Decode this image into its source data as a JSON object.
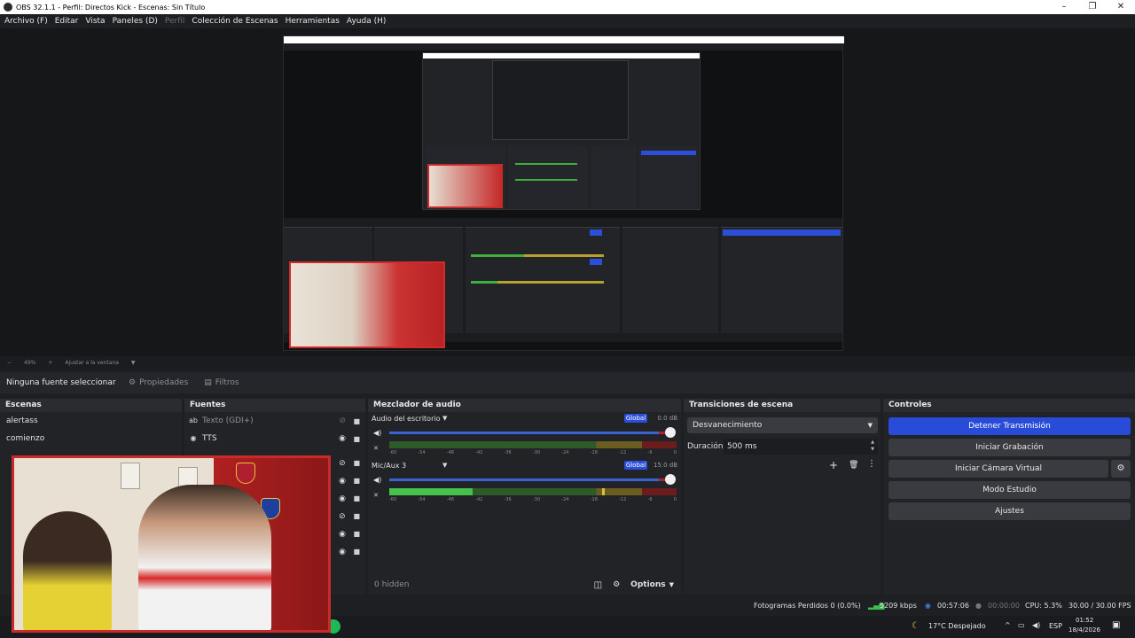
{
  "window": {
    "title": "OBS 32.1.1 - Perfil: Directos Kick - Escenas: Sin Título",
    "controls": [
      "–",
      "❐",
      "✕"
    ]
  },
  "menu": [
    "Archivo (F)",
    "Editar",
    "Vista",
    "Paneles (D)",
    "Perfil",
    "Colección de Escenas",
    "Herramientas",
    "Ayuda (H)"
  ],
  "scale": {
    "zoom": "49%",
    "fit_label": "Ajustar a la ventana"
  },
  "source_toolbar": {
    "no_source": "Ninguna fuente seleccionar",
    "properties": "Propiedades",
    "filters": "Filtros"
  },
  "docks": {
    "scenes": {
      "title": "Escenas",
      "items": [
        "alertass",
        "comienzo"
      ]
    },
    "sources": {
      "title": "Fuentes",
      "items": [
        {
          "icon": "text-icon",
          "label": "Texto (GDI+)",
          "visible": false
        },
        {
          "icon": "browser-icon",
          "label": "TTS",
          "visible": true
        }
      ]
    },
    "mixer": {
      "title": "Mezclador de audio",
      "channels": [
        {
          "name": "Audio del escritorio",
          "badge": "Global",
          "db": "0.0 dB",
          "level": 0.0
        },
        {
          "name": "Mic/Aux 3",
          "badge": "Global",
          "db": "15.0 dB",
          "level": 0.29
        }
      ],
      "ticks": [
        "-60",
        "-54",
        "-48",
        "-42",
        "-36",
        "-30",
        "-24",
        "-18",
        "-12",
        "-6",
        "0"
      ],
      "hidden": "0 hidden",
      "options": "Options"
    },
    "transitions": {
      "title": "Transiciones de escena",
      "selected": "Desvanecimiento",
      "duration_label": "Duración",
      "duration_value": "500 ms"
    },
    "controls": {
      "title": "Controles",
      "stop_stream": "Detener Transmisión",
      "start_record": "Iniciar Grabación",
      "virtual_cam": "Iniciar Cámara Virtual",
      "studio_mode": "Modo Estudio",
      "settings": "Ajustes"
    }
  },
  "status": {
    "dropped": "Fotogramas Perdidos 0 (0.0%)",
    "bitrate": "5209 kbps",
    "live_time": "00:57:06",
    "rec_time": "00:00:00",
    "cpu": "CPU: 5.3%",
    "fps": "30.00 / 30.00 FPS"
  },
  "taskbar": {
    "weather": "17°C  Despejado",
    "lang": "ESP",
    "time": "01:52",
    "date": "18/4/2026"
  },
  "colors": {
    "accent": "#284cd8",
    "live_green": "#2fbf4f",
    "cam_border": "#c92a2a"
  }
}
